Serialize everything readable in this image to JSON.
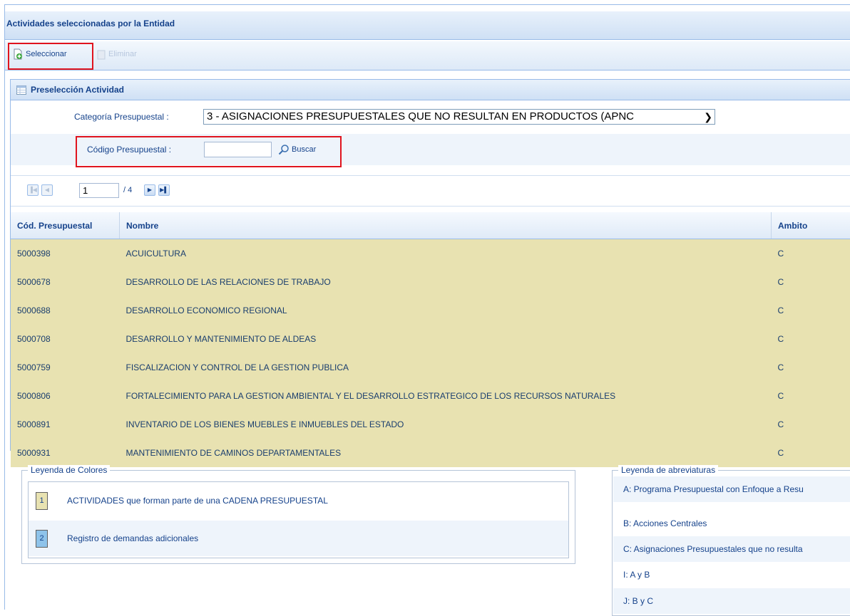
{
  "window": {
    "title": "Actividades seleccionadas por la Entidad"
  },
  "toolbar": {
    "select_label": "Seleccionar",
    "delete_label": "Eliminar"
  },
  "panel": {
    "title": "Preselección Actividad"
  },
  "form": {
    "category_label": "Categoría Presupuestal :",
    "category_value": "3 - ASIGNACIONES PRESUPUESTALES QUE NO RESULTAN EN PRODUCTOS (APNC",
    "code_label": "Código Presupuestal :",
    "code_value": "",
    "search_label": "Buscar"
  },
  "pager": {
    "current_page": "1",
    "total_pages": "/ 4"
  },
  "table": {
    "headers": [
      "Cód. Presupuestal",
      "Nombre",
      "Ambito"
    ],
    "rows": [
      {
        "code": "5000398",
        "name": "ACUICULTURA",
        "scope": "C"
      },
      {
        "code": "5000678",
        "name": "DESARROLLO DE LAS RELACIONES DE TRABAJO",
        "scope": "C"
      },
      {
        "code": "5000688",
        "name": "DESARROLLO ECONOMICO REGIONAL",
        "scope": "C"
      },
      {
        "code": "5000708",
        "name": "DESARROLLO Y MANTENIMIENTO DE ALDEAS",
        "scope": "C"
      },
      {
        "code": "5000759",
        "name": "FISCALIZACION Y CONTROL DE LA GESTION PUBLICA",
        "scope": "C"
      },
      {
        "code": "5000806",
        "name": "FORTALECIMIENTO PARA LA GESTION AMBIENTAL Y EL DESARROLLO ESTRATEGICO DE LOS RECURSOS NATURALES",
        "scope": "C"
      },
      {
        "code": "5000891",
        "name": "INVENTARIO DE LOS BIENES MUEBLES E INMUEBLES DEL ESTADO",
        "scope": "C"
      },
      {
        "code": "5000931",
        "name": "MANTENIMIENTO DE CAMINOS DEPARTAMENTALES",
        "scope": "C"
      }
    ]
  },
  "color_legend": {
    "title": "Leyenda de Colores",
    "items": [
      {
        "swatch": "1",
        "label": "ACTIVIDADES que forman parte de una CADENA PRESUPUESTAL",
        "color": "#e8e2b1"
      },
      {
        "swatch": "2",
        "label": "Registro de demandas adicionales",
        "color": "#8ec3ea"
      }
    ]
  },
  "abbr_legend": {
    "title": "Leyenda de abreviaturas",
    "items": [
      "A: Programa Presupuestal con Enfoque a Resu",
      "B: Acciones Centrales",
      "C: Asignaciones Presupuestales que no resulta",
      "I: A y B",
      "J: B y C"
    ]
  },
  "colors": {
    "row_bg": "#e8e2b1",
    "highlight": "#e0141e",
    "header_text": "#15428b"
  }
}
